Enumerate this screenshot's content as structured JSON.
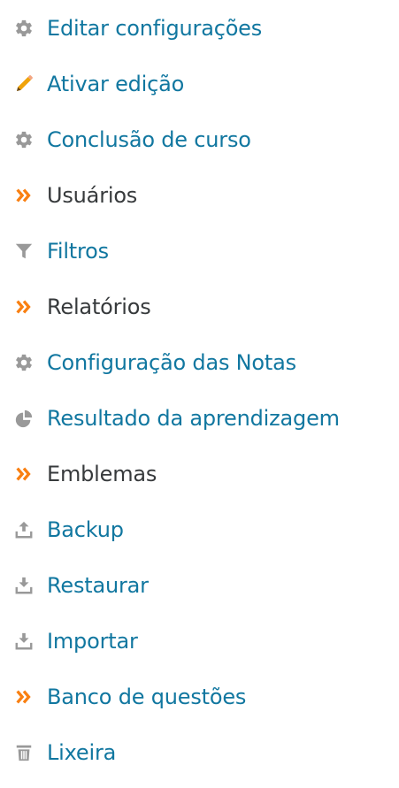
{
  "menu": {
    "items": [
      {
        "label": "Editar configurações",
        "icon": "gear-icon",
        "kind": "link"
      },
      {
        "label": "Ativar edição",
        "icon": "pencil-icon",
        "kind": "link"
      },
      {
        "label": "Conclusão de curso",
        "icon": "gear-icon",
        "kind": "link"
      },
      {
        "label": "Usuários",
        "icon": "double-chevron-right-icon",
        "kind": "plain"
      },
      {
        "label": "Filtros",
        "icon": "filter-icon",
        "kind": "link"
      },
      {
        "label": "Relatórios",
        "icon": "double-chevron-right-icon",
        "kind": "plain"
      },
      {
        "label": "Configuração das Notas",
        "icon": "gear-icon",
        "kind": "link"
      },
      {
        "label": "Resultado da aprendizagem",
        "icon": "pie-chart-icon",
        "kind": "link"
      },
      {
        "label": "Emblemas",
        "icon": "double-chevron-right-icon",
        "kind": "plain"
      },
      {
        "label": "Backup",
        "icon": "upload-icon",
        "kind": "link"
      },
      {
        "label": "Restaurar",
        "icon": "download-icon",
        "kind": "link"
      },
      {
        "label": "Importar",
        "icon": "download-icon",
        "kind": "link"
      },
      {
        "label": "Banco de questões",
        "icon": "double-chevron-right-icon",
        "kind": "link"
      },
      {
        "label": "Lixeira",
        "icon": "trash-icon",
        "kind": "link"
      }
    ]
  },
  "colors": {
    "link": "#1177a0",
    "plain_text": "#373a3c",
    "gray_icon": "#999999",
    "accent_orange": "#f98012"
  }
}
